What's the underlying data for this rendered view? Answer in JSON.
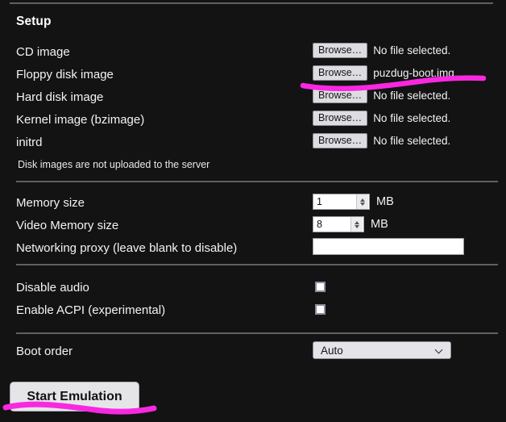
{
  "section": {
    "title": "Setup"
  },
  "file_rows": [
    {
      "label": "CD image",
      "button": "Browse…",
      "value": "No file selected."
    },
    {
      "label": "Floppy disk image",
      "button": "Browse…",
      "value": "puzdug-boot.img"
    },
    {
      "label": "Hard disk image",
      "button": "Browse…",
      "value": "No file selected."
    },
    {
      "label": "Kernel image (bzimage)",
      "button": "Browse…",
      "value": "No file selected."
    },
    {
      "label": "initrd",
      "button": "Browse…",
      "value": "No file selected."
    }
  ],
  "disk_note": "Disk images are not uploaded to the server",
  "memory": {
    "label": "Memory size",
    "value": "1",
    "unit": "MB"
  },
  "video_memory": {
    "label": "Video Memory size",
    "value": "8",
    "unit": "MB"
  },
  "network_proxy": {
    "label": "Networking proxy (leave blank to disable)",
    "value": "",
    "placeholder": ""
  },
  "toggles": [
    {
      "label": "Disable audio",
      "checked": false
    },
    {
      "label": "Enable ACPI (experimental)",
      "checked": false
    }
  ],
  "boot_order": {
    "label": "Boot order",
    "selected": "Auto",
    "options": [
      "Auto"
    ]
  },
  "start_button": {
    "label": "Start Emulation"
  },
  "colors": {
    "background": "#131314",
    "text": "#f3f3f3",
    "control_face": "#dddde1",
    "control_border": "#8c8c96",
    "divider": "#5f6063",
    "annotation": "#f828e0"
  },
  "annotations": [
    {
      "name": "floppy-highlight-stroke"
    },
    {
      "name": "start-button-highlight-stroke"
    }
  ]
}
